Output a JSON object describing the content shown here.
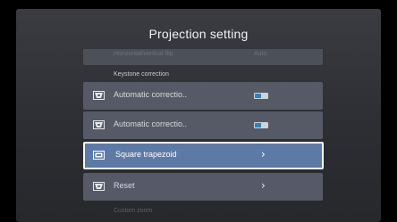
{
  "title": "Projection setting",
  "partial_row": {
    "label": "Horizontal/vertical flip",
    "value": "Auto"
  },
  "section_label": "Keystone correction",
  "rows": [
    {
      "label": "Automatic correctio..",
      "control": "toggle",
      "icon": "keystone-icon"
    },
    {
      "label": "Automatic correctio..",
      "control": "toggle",
      "icon": "keystone-icon"
    },
    {
      "label": "Square trapezoid",
      "control": "chevron",
      "icon": "square-trapezoid-icon",
      "focused": true
    },
    {
      "label": "Reset",
      "control": "chevron",
      "icon": "reset-icon"
    }
  ],
  "next_section_label": "Custom zoom",
  "chevron": "›",
  "colors": {
    "focus_bg": "#5d7aa7",
    "row_bg": "#555a66",
    "toggle_on": "#2e84b8"
  }
}
